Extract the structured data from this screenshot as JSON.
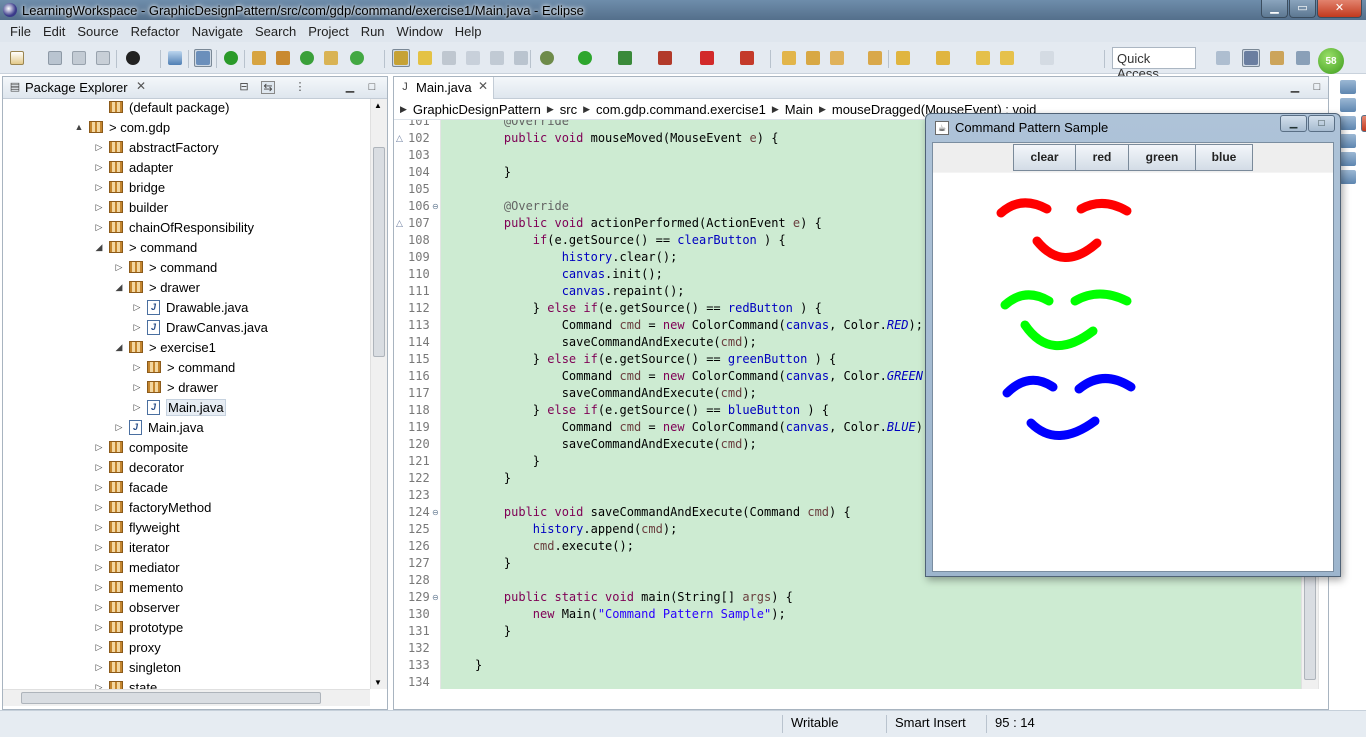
{
  "window": {
    "title": "LearningWorkspace - GraphicDesignPattern/src/com/gdp/command/exercise1/Main.java - Eclipse",
    "min": "▁",
    "max": "▭",
    "close": "✕"
  },
  "menu": [
    "File",
    "Edit",
    "Source",
    "Refactor",
    "Navigate",
    "Search",
    "Project",
    "Run",
    "Window",
    "Help"
  ],
  "quick_access": "Quick Access",
  "user_badge": "58",
  "toolbar_icons": [
    "new-icon",
    "save-icon",
    "save-all-icon",
    "print-icon",
    "open-perspective-icon",
    "debug-icon",
    "run-icon",
    "coverage-icon",
    "external-tools-icon",
    "new-java-project-icon",
    "new-package-icon",
    "new-class-icon",
    "open-type-icon",
    "search-icon",
    "next-annotation-icon",
    "prev-annotation-icon",
    "back-icon",
    "forward-icon"
  ],
  "package_explorer": {
    "title": "Package Explorer",
    "close": "✕",
    "tree": [
      {
        "label": "(default package)",
        "icon": "package",
        "depth": 4
      },
      {
        "label": "> com.gdp",
        "icon": "package",
        "depth": 3,
        "twisty": "▲"
      },
      {
        "label": "abstractFactory",
        "icon": "package",
        "depth": 4,
        "twisty": "▷"
      },
      {
        "label": "adapter",
        "icon": "package",
        "depth": 4,
        "twisty": "▷"
      },
      {
        "label": "bridge",
        "icon": "package",
        "depth": 4,
        "twisty": "▷"
      },
      {
        "label": "builder",
        "icon": "package",
        "depth": 4,
        "twisty": "▷"
      },
      {
        "label": "chainOfResponsibility",
        "icon": "package",
        "depth": 4,
        "twisty": "▷"
      },
      {
        "label": "> command",
        "icon": "package",
        "depth": 4,
        "twisty": "◢"
      },
      {
        "label": "> command",
        "icon": "package",
        "depth": 5,
        "twisty": "▷"
      },
      {
        "label": "> drawer",
        "icon": "package",
        "depth": 5,
        "twisty": "◢"
      },
      {
        "label": "Drawable.java",
        "icon": "java",
        "depth": 6,
        "twisty": "▷"
      },
      {
        "label": "DrawCanvas.java",
        "icon": "java",
        "depth": 6,
        "twisty": "▷"
      },
      {
        "label": "> exercise1",
        "icon": "package",
        "depth": 5,
        "twisty": "◢"
      },
      {
        "label": "> command",
        "icon": "package",
        "depth": 6,
        "twisty": "▷"
      },
      {
        "label": "> drawer",
        "icon": "package",
        "depth": 6,
        "twisty": "▷"
      },
      {
        "label": "Main.java",
        "icon": "java",
        "depth": 6,
        "twisty": "▷",
        "selected": true
      },
      {
        "label": "Main.java",
        "icon": "java",
        "depth": 5,
        "twisty": "▷"
      },
      {
        "label": "composite",
        "icon": "package",
        "depth": 4,
        "twisty": "▷"
      },
      {
        "label": "decorator",
        "icon": "package",
        "depth": 4,
        "twisty": "▷"
      },
      {
        "label": "facade",
        "icon": "package",
        "depth": 4,
        "twisty": "▷"
      },
      {
        "label": "factoryMethod",
        "icon": "package",
        "depth": 4,
        "twisty": "▷"
      },
      {
        "label": "flyweight",
        "icon": "package",
        "depth": 4,
        "twisty": "▷"
      },
      {
        "label": "iterator",
        "icon": "package",
        "depth": 4,
        "twisty": "▷"
      },
      {
        "label": "mediator",
        "icon": "package",
        "depth": 4,
        "twisty": "▷"
      },
      {
        "label": "memento",
        "icon": "package",
        "depth": 4,
        "twisty": "▷"
      },
      {
        "label": "observer",
        "icon": "package",
        "depth": 4,
        "twisty": "▷"
      },
      {
        "label": "prototype",
        "icon": "package",
        "depth": 4,
        "twisty": "▷"
      },
      {
        "label": "proxy",
        "icon": "package",
        "depth": 4,
        "twisty": "▷"
      },
      {
        "label": "singleton",
        "icon": "package",
        "depth": 4,
        "twisty": "▷"
      },
      {
        "label": "state",
        "icon": "package",
        "depth": 4,
        "twisty": "▷"
      }
    ]
  },
  "editor": {
    "tab": "Main.java",
    "tab_close": "✕",
    "breadcrumb": [
      "GraphicDesignPattern",
      "src",
      "com.gdp.command.exercise1",
      "Main",
      "mouseDragged(MouseEvent) : void"
    ],
    "lines": [
      {
        "n": "101",
        "code": [
          [
            "ann",
            "    @Override"
          ]
        ]
      },
      {
        "n": "102",
        "code": [
          [
            "kw",
            "    public void "
          ],
          [
            "",
            "mouseMoved(MouseEvent "
          ],
          [
            "var",
            "e"
          ],
          [
            "",
            ") {"
          ]
        ],
        "ov": true
      },
      {
        "n": "103",
        "code": []
      },
      {
        "n": "104",
        "code": [
          [
            "",
            "    }"
          ]
        ]
      },
      {
        "n": "105",
        "code": []
      },
      {
        "n": "106",
        "code": [
          [
            "ann",
            "    @Override"
          ]
        ],
        "fold": true
      },
      {
        "n": "107",
        "code": [
          [
            "kw",
            "    public void "
          ],
          [
            "",
            "actionPerformed(ActionEvent "
          ],
          [
            "var",
            "e"
          ],
          [
            "",
            ") {"
          ]
        ],
        "ov": true
      },
      {
        "n": "108",
        "code": [
          [
            "kw",
            "        if"
          ],
          [
            "",
            "(e.getSource() == "
          ],
          [
            "fld",
            "clearButton"
          ],
          [
            "",
            " ) {"
          ]
        ]
      },
      {
        "n": "109",
        "code": [
          [
            "fld",
            "            history"
          ],
          [
            "",
            ".clear();"
          ]
        ]
      },
      {
        "n": "110",
        "code": [
          [
            "fld",
            "            canvas"
          ],
          [
            "",
            ".init();"
          ]
        ]
      },
      {
        "n": "111",
        "code": [
          [
            "fld",
            "            canvas"
          ],
          [
            "",
            ".repaint();"
          ]
        ]
      },
      {
        "n": "112",
        "code": [
          [
            "",
            "        } "
          ],
          [
            "kw",
            "else if"
          ],
          [
            "",
            "(e.getSource() == "
          ],
          [
            "fld",
            "redButton"
          ],
          [
            "",
            " ) {"
          ]
        ]
      },
      {
        "n": "113",
        "code": [
          [
            "",
            "            Command "
          ],
          [
            "var",
            "cmd"
          ],
          [
            "",
            " = "
          ],
          [
            "kw",
            "new "
          ],
          [
            "",
            "ColorCommand("
          ],
          [
            "fld",
            "canvas"
          ],
          [
            "",
            ", Color."
          ],
          [
            "ital",
            "RED"
          ],
          [
            "",
            ");"
          ]
        ]
      },
      {
        "n": "114",
        "code": [
          [
            "",
            "            saveCommandAndExecute("
          ],
          [
            "var",
            "cmd"
          ],
          [
            "",
            ");"
          ]
        ]
      },
      {
        "n": "115",
        "code": [
          [
            "",
            "        } "
          ],
          [
            "kw",
            "else if"
          ],
          [
            "",
            "(e.getSource() == "
          ],
          [
            "fld",
            "greenButton"
          ],
          [
            "",
            " ) {"
          ]
        ]
      },
      {
        "n": "116",
        "code": [
          [
            "",
            "            Command "
          ],
          [
            "var",
            "cmd"
          ],
          [
            "",
            " = "
          ],
          [
            "kw",
            "new "
          ],
          [
            "",
            "ColorCommand("
          ],
          [
            "fld",
            "canvas"
          ],
          [
            "",
            ", Color."
          ],
          [
            "ital",
            "GREEN"
          ],
          [
            "",
            ");"
          ]
        ]
      },
      {
        "n": "117",
        "code": [
          [
            "",
            "            saveCommandAndExecute("
          ],
          [
            "var",
            "cmd"
          ],
          [
            "",
            ");"
          ]
        ]
      },
      {
        "n": "118",
        "code": [
          [
            "",
            "        } "
          ],
          [
            "kw",
            "else if"
          ],
          [
            "",
            "(e.getSource() == "
          ],
          [
            "fld",
            "blueButton"
          ],
          [
            "",
            " ) {"
          ]
        ]
      },
      {
        "n": "119",
        "code": [
          [
            "",
            "            Command "
          ],
          [
            "var",
            "cmd"
          ],
          [
            "",
            " = "
          ],
          [
            "kw",
            "new "
          ],
          [
            "",
            "ColorCommand("
          ],
          [
            "fld",
            "canvas"
          ],
          [
            "",
            ", Color."
          ],
          [
            "ital",
            "BLUE"
          ],
          [
            "",
            ");"
          ]
        ]
      },
      {
        "n": "120",
        "code": [
          [
            "",
            "            saveCommandAndExecute("
          ],
          [
            "var",
            "cmd"
          ],
          [
            "",
            ");"
          ]
        ]
      },
      {
        "n": "121",
        "code": [
          [
            "",
            "        }"
          ]
        ]
      },
      {
        "n": "122",
        "code": [
          [
            "",
            "    }"
          ]
        ]
      },
      {
        "n": "123",
        "code": []
      },
      {
        "n": "124",
        "code": [
          [
            "kw",
            "    public void "
          ],
          [
            "",
            "saveCommandAndExecute(Command "
          ],
          [
            "var",
            "cmd"
          ],
          [
            "",
            ") {"
          ]
        ],
        "fold": true
      },
      {
        "n": "125",
        "code": [
          [
            "fld",
            "        history"
          ],
          [
            "",
            ".append("
          ],
          [
            "var",
            "cmd"
          ],
          [
            "",
            ");"
          ]
        ]
      },
      {
        "n": "126",
        "code": [
          [
            "var",
            "        cmd"
          ],
          [
            "",
            ".execute();"
          ]
        ]
      },
      {
        "n": "127",
        "code": [
          [
            "",
            "    }"
          ]
        ]
      },
      {
        "n": "128",
        "code": []
      },
      {
        "n": "129",
        "code": [
          [
            "kw",
            "    public static void "
          ],
          [
            "",
            "main(String[] "
          ],
          [
            "var",
            "args"
          ],
          [
            "",
            ") {"
          ]
        ],
        "fold": true
      },
      {
        "n": "130",
        "code": [
          [
            "kw",
            "        new "
          ],
          [
            "",
            "Main("
          ],
          [
            "str",
            "\"Command Pattern Sample\""
          ],
          [
            "",
            ");"
          ]
        ]
      },
      {
        "n": "131",
        "code": [
          [
            "",
            "    }"
          ]
        ]
      },
      {
        "n": "132",
        "code": []
      },
      {
        "n": "133",
        "code": [
          [
            "",
            "}"
          ]
        ]
      },
      {
        "n": "134",
        "code": []
      }
    ]
  },
  "status": {
    "writable": "Writable",
    "insert_mode": "Smart Insert",
    "position": "95 : 14"
  },
  "app_window": {
    "title": "Command Pattern Sample",
    "buttons": [
      "clear",
      "red",
      "green",
      "blue"
    ],
    "stroke_colors": {
      "red": "#ff0000",
      "green": "#00ff00",
      "blue": "#0000ff"
    }
  }
}
